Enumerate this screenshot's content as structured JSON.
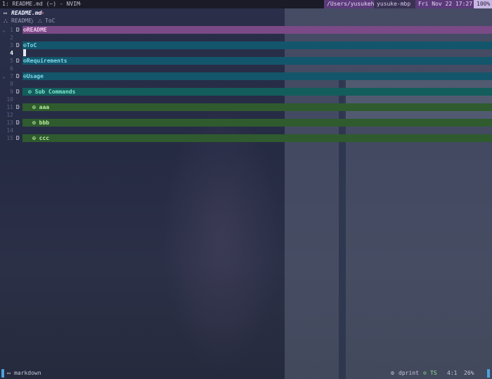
{
  "tmux": {
    "window_title": "1: README.md (~) - NVIM",
    "new_window": "+",
    "path": "/Users/yusukeh",
    "host": "yusuke-mbp",
    "datetime": "Fri Nov 22 17:27",
    "battery": "100%"
  },
  "buffer": {
    "filetype_icon": "▭",
    "filename": "README.md",
    "close": "×"
  },
  "breadcrumb": {
    "icon": "⛬",
    "items": [
      "README",
      "ToC"
    ],
    "separator": "〉"
  },
  "editor": {
    "lines": [
      {
        "num": "1",
        "fold": "⌄",
        "mark": "Ɒ",
        "text": "⊙README",
        "style": "pink",
        "indent": 0
      },
      {
        "num": "2",
        "fold": "",
        "mark": "",
        "text": "",
        "style": "",
        "indent": 0
      },
      {
        "num": "3",
        "fold": "",
        "mark": "Ɒ",
        "text": "⊙ToC",
        "style": "teal",
        "indent": 1
      },
      {
        "num": "4",
        "fold": "",
        "mark": "",
        "text": "",
        "style": "",
        "indent": 0,
        "current": true
      },
      {
        "num": "5",
        "fold": "",
        "mark": "Ɒ",
        "text": "⊙Requirements",
        "style": "teal",
        "indent": 1
      },
      {
        "num": "6",
        "fold": "",
        "mark": "",
        "text": "",
        "style": "",
        "indent": 0
      },
      {
        "num": "7",
        "fold": "⌄",
        "mark": "Ɒ",
        "text": "⊙Usage",
        "style": "teal",
        "indent": 1
      },
      {
        "num": "8",
        "fold": "",
        "mark": "",
        "text": "",
        "style": "",
        "indent": 0
      },
      {
        "num": "9",
        "fold": "",
        "mark": "Ɒ",
        "text": "⊙ Sub Commands",
        "style": "teal2",
        "indent": 2
      },
      {
        "num": "10",
        "fold": "",
        "mark": "",
        "text": "",
        "style": "",
        "indent": 0
      },
      {
        "num": "11",
        "fold": "",
        "mark": "Ɒ",
        "text": "⊙ aaa",
        "style": "green",
        "indent": 3
      },
      {
        "num": "12",
        "fold": "",
        "mark": "",
        "text": "",
        "style": "",
        "indent": 0
      },
      {
        "num": "13",
        "fold": "",
        "mark": "Ɒ",
        "text": "⊙ bbb",
        "style": "green",
        "indent": 3
      },
      {
        "num": "14",
        "fold": "",
        "mark": "",
        "text": "",
        "style": "",
        "indent": 0
      },
      {
        "num": "15",
        "fold": "",
        "mark": "Ɒ",
        "text": "⊙ ccc",
        "style": "green",
        "indent": 3
      }
    ]
  },
  "statusline": {
    "filetype_icon": "▭",
    "filetype": "markdown",
    "formatter_icon": "⚙",
    "formatter": "dprint",
    "ts_icon": "⊙",
    "ts": "TS",
    "position": "4:1",
    "percent": "26%"
  },
  "colors": {
    "pink": "#7a4a86",
    "teal": "#13566b",
    "green": "#2f5b2e",
    "accent": "#4aa3e0"
  }
}
